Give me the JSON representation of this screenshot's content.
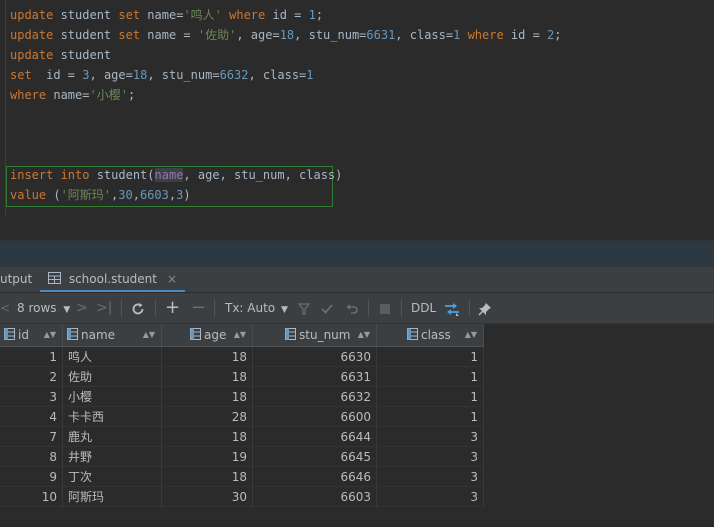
{
  "editor": {
    "lines": [
      [
        [
          "kw",
          "update"
        ],
        [
          "t",
          " student "
        ],
        [
          "kw",
          "set"
        ],
        [
          "t",
          " name="
        ],
        [
          "str",
          "'鸣人'"
        ],
        [
          "t",
          " "
        ],
        [
          "kw",
          "where"
        ],
        [
          "t",
          " id = "
        ],
        [
          "num",
          "1"
        ],
        [
          "t",
          ";"
        ]
      ],
      [
        [
          "kw",
          "update"
        ],
        [
          "t",
          " student "
        ],
        [
          "kw",
          "set"
        ],
        [
          "t",
          " name = "
        ],
        [
          "str",
          "'佐助'"
        ],
        [
          "t",
          ", age="
        ],
        [
          "num",
          "18"
        ],
        [
          "t",
          ", stu_num="
        ],
        [
          "num",
          "6631"
        ],
        [
          "t",
          ", class="
        ],
        [
          "num",
          "1"
        ],
        [
          "t",
          " "
        ],
        [
          "kw",
          "where"
        ],
        [
          "t",
          " id = "
        ],
        [
          "num",
          "2"
        ],
        [
          "t",
          ";"
        ]
      ],
      [
        [
          "kw",
          "update"
        ],
        [
          "t",
          " student"
        ]
      ],
      [
        [
          "kw",
          "set"
        ],
        [
          "t",
          "  id = "
        ],
        [
          "num",
          "3"
        ],
        [
          "t",
          ", age="
        ],
        [
          "num",
          "18"
        ],
        [
          "t",
          ", stu_num="
        ],
        [
          "num",
          "6632"
        ],
        [
          "t",
          ", class="
        ],
        [
          "num",
          "1"
        ]
      ],
      [
        [
          "kw",
          "where"
        ],
        [
          "t",
          " name="
        ],
        [
          "str",
          "'小樱'"
        ],
        [
          "t",
          ";"
        ]
      ],
      [],
      [],
      [],
      [
        [
          "kw",
          "insert into"
        ],
        [
          "t",
          " student("
        ],
        [
          "hl",
          "name"
        ],
        [
          "t",
          ", age, stu_num, class)"
        ]
      ],
      [
        [
          "kw",
          "value"
        ],
        [
          "t",
          " ("
        ],
        [
          "str",
          "'阿斯玛'"
        ],
        [
          "t",
          ","
        ],
        [
          "num",
          "30"
        ],
        [
          "t",
          ","
        ],
        [
          "num",
          "6603"
        ],
        [
          "t",
          ","
        ],
        [
          "num",
          "3"
        ],
        [
          "t",
          ")"
        ]
      ]
    ]
  },
  "tabs": {
    "output_label": "utput",
    "active_label": "school.student",
    "close_glyph": "×"
  },
  "toolbar": {
    "rows_label": "8 rows",
    "tx_label": "Tx: Auto",
    "ddl_label": "DDL"
  },
  "grid": {
    "columns": [
      "id",
      "name",
      "age",
      "stu_num",
      "class"
    ],
    "rows": [
      [
        "1",
        "鸣人",
        "18",
        "6630",
        "1"
      ],
      [
        "2",
        "佐助",
        "18",
        "6631",
        "1"
      ],
      [
        "3",
        "小樱",
        "18",
        "6632",
        "1"
      ],
      [
        "4",
        "卡卡西",
        "28",
        "6600",
        "1"
      ],
      [
        "7",
        "鹿丸",
        "18",
        "6644",
        "3"
      ],
      [
        "8",
        "井野",
        "19",
        "6645",
        "3"
      ],
      [
        "9",
        "丁次",
        "18",
        "6646",
        "3"
      ],
      [
        "10",
        "阿斯玛",
        "30",
        "6603",
        "3"
      ]
    ]
  }
}
